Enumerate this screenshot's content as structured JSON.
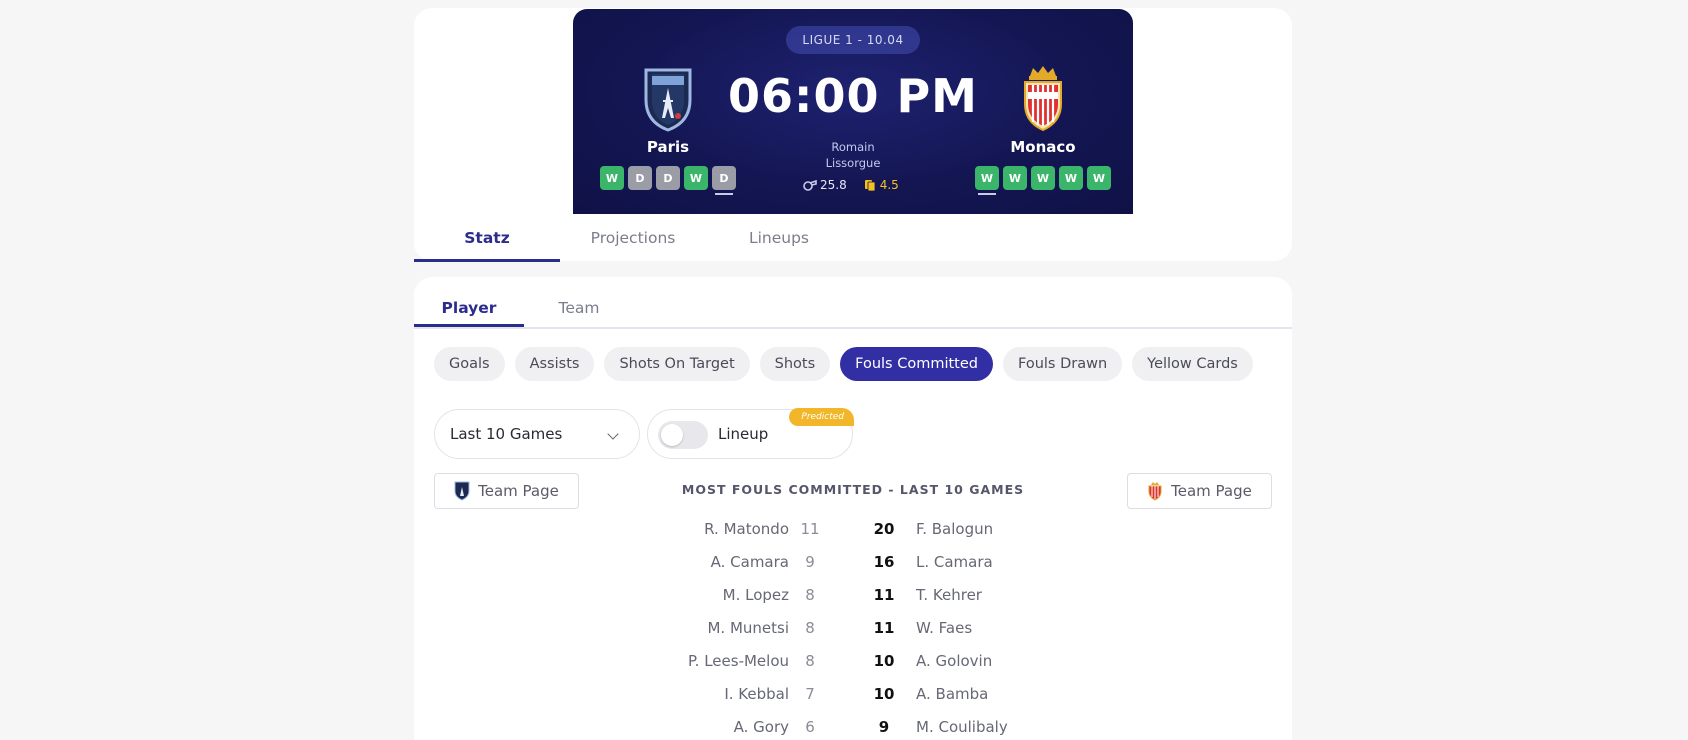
{
  "match": {
    "league": "LIGUE 1 - 10.04",
    "kickoff": "06:00 PM",
    "referee_first": "Romain",
    "referee_last": "Lissorgue",
    "ref_fouls": "25.8",
    "ref_cards": "4.5",
    "home": {
      "name": "Paris",
      "form": [
        "W",
        "D",
        "D",
        "W",
        "D"
      ]
    },
    "away": {
      "name": "Monaco",
      "form": [
        "W",
        "W",
        "W",
        "W",
        "W"
      ]
    }
  },
  "main_tabs": [
    "Statz",
    "Projections",
    "Lineups"
  ],
  "sub_tabs": [
    "Player",
    "Team"
  ],
  "chips": [
    "Goals",
    "Assists",
    "Shots On Target",
    "Shots",
    "Fouls Committed",
    "Fouls Drawn",
    "Yellow Cards"
  ],
  "active_chip": "Fouls Committed",
  "filters": {
    "range": "Last 10 Games",
    "lineup_label": "Lineup",
    "predicted_label": "Predicted"
  },
  "team_page_label": "Team Page",
  "table_title": "MOST FOULS COMMITTED - LAST 10 GAMES",
  "rows": [
    {
      "home_player": "R. Matondo",
      "home_val": "11",
      "away_val": "20",
      "away_player": "F. Balogun"
    },
    {
      "home_player": "A. Camara",
      "home_val": "9",
      "away_val": "16",
      "away_player": "L. Camara"
    },
    {
      "home_player": "M. Lopez",
      "home_val": "8",
      "away_val": "11",
      "away_player": "T. Kehrer"
    },
    {
      "home_player": "M. Munetsi",
      "home_val": "8",
      "away_val": "11",
      "away_player": "W. Faes"
    },
    {
      "home_player": "P. Lees-Melou",
      "home_val": "8",
      "away_val": "10",
      "away_player": "A. Golovin"
    },
    {
      "home_player": "I. Kebbal",
      "home_val": "7",
      "away_val": "10",
      "away_player": "A. Bamba"
    },
    {
      "home_player": "A. Gory",
      "home_val": "6",
      "away_val": "9",
      "away_player": "M. Coulibaly"
    }
  ],
  "colors": {
    "brand": "#312fa3",
    "header_bg": "#141653",
    "win": "#3bb56a",
    "draw": "#9a9ca6",
    "card": "#f4c21e",
    "predicted": "#f2b62b"
  },
  "icons": [
    "paris-fc-crest-icon",
    "monaco-crest-icon",
    "whistle-icon",
    "yellow-card-icon",
    "chevron-down-icon"
  ]
}
